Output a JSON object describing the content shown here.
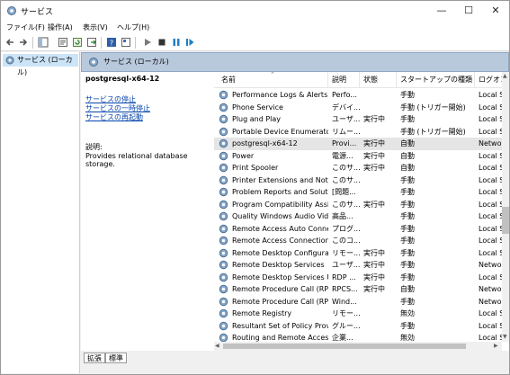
{
  "window": {
    "title": "サービス",
    "minimize_glyph": "—",
    "maximize_glyph": "☐",
    "close_glyph": "✕"
  },
  "menu": [
    "ファイル(F)",
    "操作(A)",
    "表示(V)",
    "ヘルプ(H)"
  ],
  "toolbar": {
    "icons": [
      "back-arrow-icon",
      "forward-arrow-icon",
      "show-hide-tree-icon",
      "properties-icon",
      "refresh-icon",
      "export-list-icon",
      "help-icon",
      "properties-view-icon",
      "start-service-icon",
      "stop-service-icon",
      "pause-service-icon",
      "restart-service-icon"
    ]
  },
  "tree": {
    "item_label": "サービス (ローカル)"
  },
  "pane": {
    "header_label": "サービス (ローカル)"
  },
  "details": {
    "service_name": "postgresql-x64-12",
    "links": [
      "サービスの停止",
      "サービスの一時停止",
      "サービスの再起動"
    ],
    "description_label": "説明:",
    "description_text": "Provides relational database storage."
  },
  "list": {
    "columns": [
      "名前",
      "説明",
      "状態",
      "スタートアップの種類",
      "ログオン"
    ],
    "rows": [
      {
        "name": "Performance Logs & Alerts",
        "desc": "Perfo...",
        "status": "",
        "startup": "手動",
        "logon": "Local S"
      },
      {
        "name": "Phone Service",
        "desc": "デバイ...",
        "status": "",
        "startup": "手動 (トリガー開始)",
        "logon": "Local S"
      },
      {
        "name": "Plug and Play",
        "desc": "ユーザ...",
        "status": "実行中",
        "startup": "手動",
        "logon": "Local S"
      },
      {
        "name": "Portable Device Enumerator...",
        "desc": "リムー...",
        "status": "",
        "startup": "手動 (トリガー開始)",
        "logon": "Local S"
      },
      {
        "name": "postgresql-x64-12",
        "desc": "Provi...",
        "status": "実行中",
        "startup": "自動",
        "logon": "Networ"
      },
      {
        "name": "Power",
        "desc": "電源...",
        "status": "実行中",
        "startup": "自動",
        "logon": "Local S"
      },
      {
        "name": "Print Spooler",
        "desc": "このサ...",
        "status": "実行中",
        "startup": "自動",
        "logon": "Local S"
      },
      {
        "name": "Printer Extensions and Notif...",
        "desc": "このサ...",
        "status": "",
        "startup": "手動",
        "logon": "Local S"
      },
      {
        "name": "Problem Reports and Soluti...",
        "desc": "[問題...",
        "status": "",
        "startup": "手動",
        "logon": "Local S"
      },
      {
        "name": "Program Compatibility Assis...",
        "desc": "このサ...",
        "status": "実行中",
        "startup": "手動",
        "logon": "Local S"
      },
      {
        "name": "Quality Windows Audio Vid...",
        "desc": "高品...",
        "status": "",
        "startup": "手動",
        "logon": "Local S"
      },
      {
        "name": "Remote Access Auto Conne...",
        "desc": "プログ...",
        "status": "",
        "startup": "手動",
        "logon": "Local S"
      },
      {
        "name": "Remote Access Connection ...",
        "desc": "このコ...",
        "status": "",
        "startup": "手動",
        "logon": "Local S"
      },
      {
        "name": "Remote Desktop Configurat...",
        "desc": "リモー...",
        "status": "実行中",
        "startup": "手動",
        "logon": "Local S"
      },
      {
        "name": "Remote Desktop Services",
        "desc": "ユーザ...",
        "status": "実行中",
        "startup": "手動",
        "logon": "Networ"
      },
      {
        "name": "Remote Desktop Services Us...",
        "desc": "RDP ...",
        "status": "実行中",
        "startup": "手動",
        "logon": "Local S"
      },
      {
        "name": "Remote Procedure Call (RPC)",
        "desc": "RPCS...",
        "status": "実行中",
        "startup": "自動",
        "logon": "Networ"
      },
      {
        "name": "Remote Procedure Call (RPC...",
        "desc": "Wind...",
        "status": "",
        "startup": "手動",
        "logon": "Networ"
      },
      {
        "name": "Remote Registry",
        "desc": "リモー...",
        "status": "",
        "startup": "無効",
        "logon": "Local S"
      },
      {
        "name": "Resultant Set of Policy Provi...",
        "desc": "グルー...",
        "status": "",
        "startup": "手動",
        "logon": "Local S"
      },
      {
        "name": "Routing and Remote Access",
        "desc": "企業...",
        "status": "",
        "startup": "無効",
        "logon": "Local S"
      }
    ]
  },
  "tabs": [
    "拡張",
    "標準"
  ],
  "colors": {
    "selection": "#cce4f7",
    "pane_header": "#b9c9dc",
    "link": "#0645ad",
    "gear": "#5b8fc7"
  }
}
